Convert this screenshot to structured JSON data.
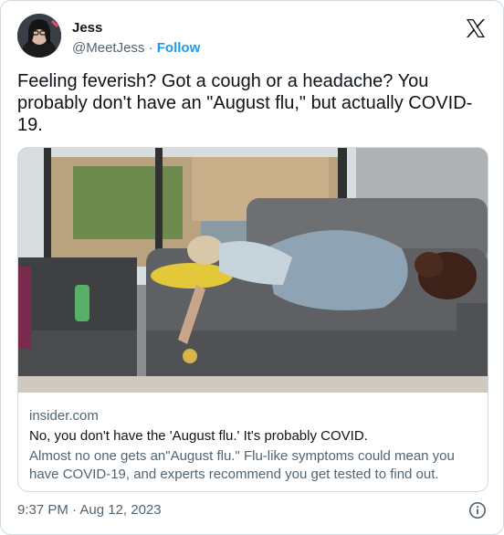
{
  "author": {
    "display_name": "Jess",
    "handle": "@MeetJess",
    "separator": " · ",
    "follow_label": "Follow",
    "avatar_icon": "profile-avatar"
  },
  "tweet": {
    "text": "Feeling feverish? Got a cough or a headache? You probably don't have an \"August flu,\" but actually COVID-19."
  },
  "link_card": {
    "domain": "insider.com",
    "title": "No, you don't have the 'August flu.' It's probably COVID.",
    "description": "Almost no one gets an\"August flu.\" Flu-like symptoms could mean you have COVID-19, and experts recommend you get tested to find out.",
    "image_icon": "woman-resting-on-sofa-with-dog-photo"
  },
  "footer": {
    "timestamp": "9:37 PM · Aug 12, 2023",
    "info_icon": "info-icon"
  },
  "colors": {
    "link_blue": "#1d9bf0",
    "text_primary": "#0f1419",
    "text_secondary": "#536471",
    "border": "#cfd9de"
  }
}
